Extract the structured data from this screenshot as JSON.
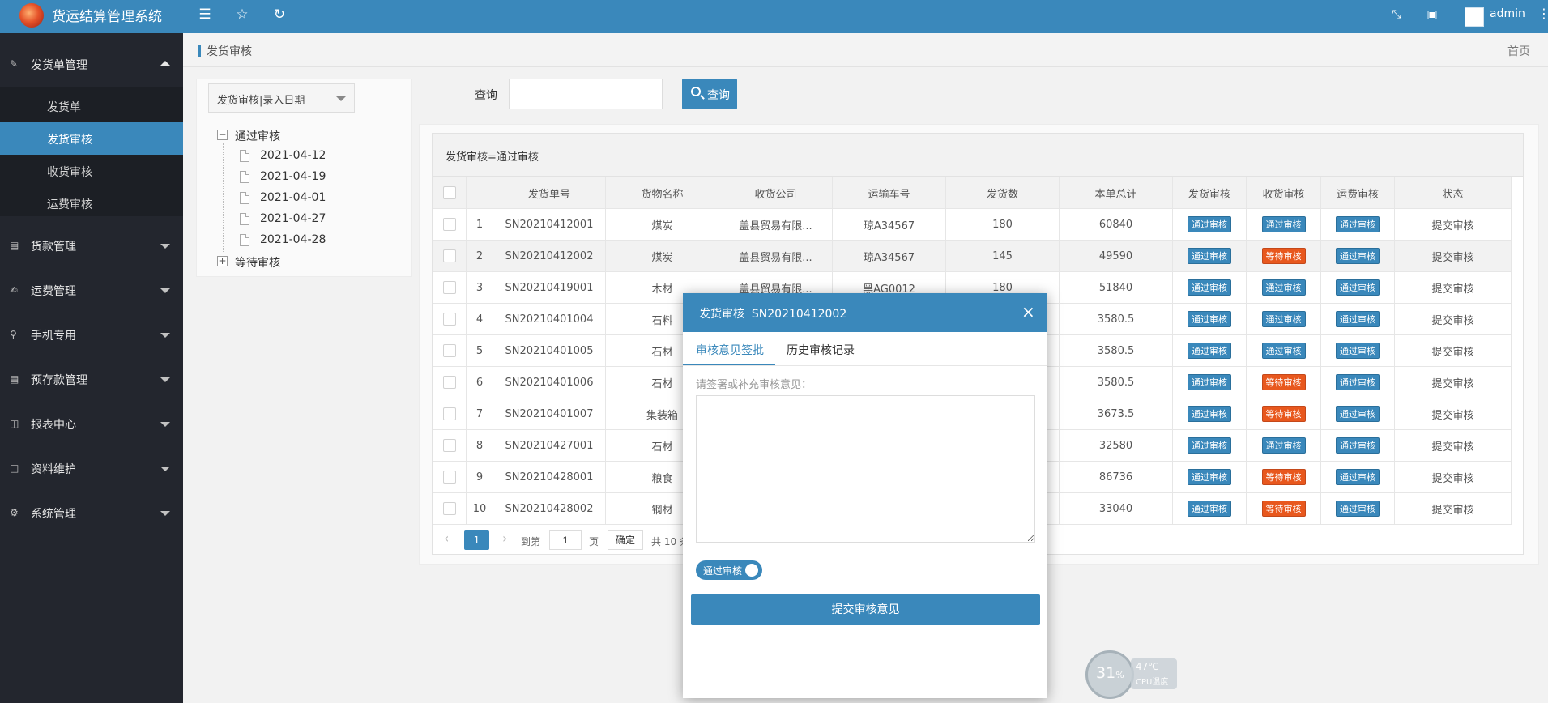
{
  "header": {
    "app_title": "货运结算管理系统",
    "user": "admin",
    "icons": [
      "menu-fold-icon",
      "star-icon",
      "refresh-icon",
      "fullscreen-icon",
      "lock-icon",
      "more-icon"
    ]
  },
  "sidebar": {
    "groups": [
      {
        "label": "发货单管理",
        "icon": "pencil-icon",
        "expanded": true
      },
      {
        "label": "货款管理",
        "icon": "document-icon"
      },
      {
        "label": "运费管理",
        "icon": "edit-doc-icon"
      },
      {
        "label": "手机专用",
        "icon": "search-icon"
      },
      {
        "label": "预存款管理",
        "icon": "ledger-icon"
      },
      {
        "label": "报表中心",
        "icon": "report-icon"
      },
      {
        "label": "资料维护",
        "icon": "file-icon"
      },
      {
        "label": "系统管理",
        "icon": "gear-icon"
      }
    ],
    "sub_items": [
      {
        "label": "发货单"
      },
      {
        "label": "发货审核",
        "active": true
      },
      {
        "label": "收货审核"
      },
      {
        "label": "运费审核"
      }
    ]
  },
  "breadcrumb": {
    "current": "发货审核",
    "home": "首页"
  },
  "tree": {
    "select_value": "发货审核|录入日期",
    "nodes": [
      {
        "label": "通过审核",
        "expanded": true,
        "children": [
          "2021-04-12",
          "2021-04-19",
          "2021-04-01",
          "2021-04-27",
          "2021-04-28"
        ]
      },
      {
        "label": "等待审核",
        "expanded": false
      }
    ]
  },
  "search": {
    "label": "查询",
    "value": "",
    "button": "查询"
  },
  "grid": {
    "title": "发货审核=通过审核",
    "columns": [
      "",
      "",
      "发货单号",
      "货物名称",
      "收货公司",
      "运输车号",
      "发货数",
      "本单总计",
      "发货审核",
      "收货审核",
      "运费审核",
      "状态"
    ],
    "rows": [
      {
        "no": "1",
        "id": "SN20210412001",
        "goods": "煤炭",
        "company": "盖县贸易有限...",
        "truck": "琼A34567",
        "qty": "180",
        "total": "60840",
        "ship": "通过审核",
        "recv": "通过审核",
        "freight": "通过审核",
        "status": "提交审核"
      },
      {
        "no": "2",
        "id": "SN20210412002",
        "goods": "煤炭",
        "company": "盖县贸易有限...",
        "truck": "琼A34567",
        "qty": "145",
        "total": "49590",
        "ship": "通过审核",
        "recv": "等待审核",
        "freight": "通过审核",
        "status": "提交审核"
      },
      {
        "no": "3",
        "id": "SN20210419001",
        "goods": "木材",
        "company": "盖县贸易有限...",
        "truck": "黑AG0012",
        "qty": "180",
        "total": "51840",
        "ship": "通过审核",
        "recv": "通过审核",
        "freight": "通过审核",
        "status": "提交审核"
      },
      {
        "no": "4",
        "id": "SN20210401004",
        "goods": "石料",
        "company": "",
        "truck": "",
        "qty": "",
        "total": "3580.5",
        "ship": "通过审核",
        "recv": "通过审核",
        "freight": "通过审核",
        "status": "提交审核"
      },
      {
        "no": "5",
        "id": "SN20210401005",
        "goods": "石材",
        "company": "",
        "truck": "",
        "qty": "",
        "total": "3580.5",
        "ship": "通过审核",
        "recv": "通过审核",
        "freight": "通过审核",
        "status": "提交审核"
      },
      {
        "no": "6",
        "id": "SN20210401006",
        "goods": "石材",
        "company": "",
        "truck": "",
        "qty": "",
        "total": "3580.5",
        "ship": "通过审核",
        "recv": "等待审核",
        "freight": "通过审核",
        "status": "提交审核"
      },
      {
        "no": "7",
        "id": "SN20210401007",
        "goods": "集装箱",
        "company": "",
        "truck": "",
        "qty": "",
        "total": "3673.5",
        "ship": "通过审核",
        "recv": "等待审核",
        "freight": "通过审核",
        "status": "提交审核"
      },
      {
        "no": "8",
        "id": "SN20210427001",
        "goods": "石材",
        "company": "",
        "truck": "",
        "qty": "",
        "total": "32580",
        "ship": "通过审核",
        "recv": "通过审核",
        "freight": "通过审核",
        "status": "提交审核"
      },
      {
        "no": "9",
        "id": "SN20210428001",
        "goods": "粮食",
        "company": "",
        "truck": "",
        "qty": "",
        "total": "86736",
        "ship": "通过审核",
        "recv": "等待审核",
        "freight": "通过审核",
        "status": "提交审核"
      },
      {
        "no": "10",
        "id": "SN20210428002",
        "goods": "钢材",
        "company": "",
        "truck": "",
        "qty": "",
        "total": "33040",
        "ship": "通过审核",
        "recv": "等待审核",
        "freight": "通过审核",
        "status": "提交审核"
      }
    ],
    "pager": {
      "current": "1",
      "goto_label": "到第",
      "goto_value": "1",
      "page_unit": "页",
      "confirm": "确定",
      "total": "共 10 条"
    }
  },
  "modal": {
    "title": "发货审核  SN20210412002",
    "close": "×",
    "tabs": [
      "审核意见签批",
      "历史审核记录"
    ],
    "hint": "请签署或补充审核意见：",
    "opinion_value": "",
    "switch_label": "通过审核",
    "submit": "提交审核意见"
  },
  "cpu_widget": {
    "percent": "31",
    "unit": "%",
    "temp": "47℃",
    "label": "CPU温度"
  },
  "colors": {
    "primary": "#3a88bb",
    "warn": "#e8581e",
    "sidebar": "#23262e"
  }
}
